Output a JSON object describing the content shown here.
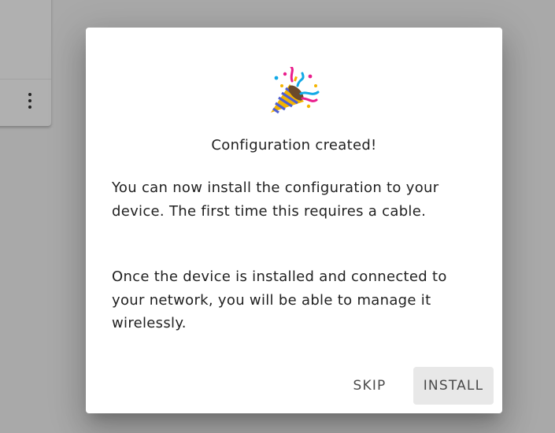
{
  "background": {
    "menu_icon": "more-vert-icon"
  },
  "dialog": {
    "icon": "party-popper-icon",
    "title": "Configuration created!",
    "paragraphs": [
      "You can now install the configuration to your device. The first time this requires a cable.",
      "Once the device is installed and connected to your network, you will be able to manage it wirelessly."
    ],
    "actions": {
      "skip_label": "SKIP",
      "install_label": "INSTALL"
    }
  },
  "colors": {
    "overlay": "#a9a9a9",
    "dialog_bg": "#ffffff",
    "text": "#212121",
    "install_bg": "#e8e8e8"
  }
}
